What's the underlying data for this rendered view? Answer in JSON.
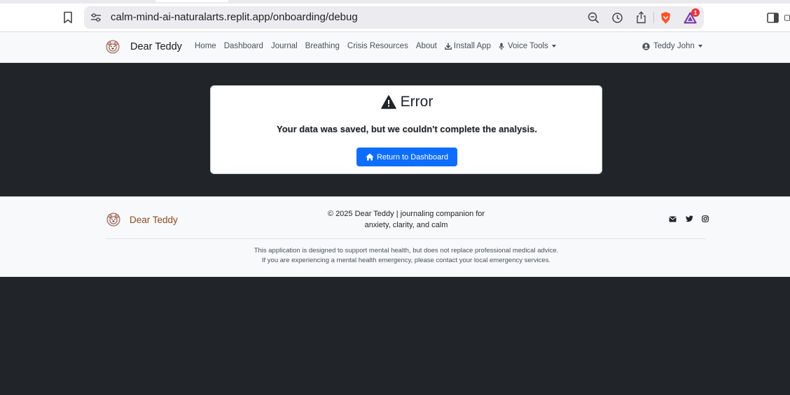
{
  "browser": {
    "url": "calm-mind-ai-naturalarts.replit.app/onboarding/debug",
    "notification_count": "1",
    "icons": [
      "bookmark-icon",
      "site-settings-icon",
      "zoom-out-icon",
      "history-icon",
      "share-icon",
      "brave-shield-icon",
      "brave-rewards-icon",
      "sidebar-toggle-icon"
    ]
  },
  "nav": {
    "brand": "Dear Teddy",
    "links": [
      {
        "label": "Home"
      },
      {
        "label": "Dashboard"
      },
      {
        "label": "Journal"
      },
      {
        "label": "Breathing"
      },
      {
        "label": "Crisis Resources"
      },
      {
        "label": "About"
      },
      {
        "label": "Install App",
        "icon": "download-icon"
      },
      {
        "label": "Voice Tools",
        "icon": "microphone-icon",
        "dropdown": true
      }
    ],
    "user": "Teddy John"
  },
  "error": {
    "title": "Error",
    "message": "Your data was saved, but we couldn't complete the analysis.",
    "button": "Return to Dashboard"
  },
  "footer": {
    "brand": "Dear Teddy",
    "copyright_line1": "© 2025 Dear Teddy | journaling companion for",
    "copyright_line2": "anxiety, clarity, and calm",
    "social": [
      "envelope-icon",
      "twitter-icon",
      "instagram-icon"
    ],
    "disclaimer_line1": "This application is designed to support mental health, but does not replace professional medical advice.",
    "disclaimer_line2": "If you are experiencing a mental health emergency, please contact your local emergency services."
  },
  "colors": {
    "page_background": "#212529",
    "primary": "#0d6efd",
    "footer_brand": "#8a4a20",
    "navbar_background": "#f8f9fa"
  }
}
